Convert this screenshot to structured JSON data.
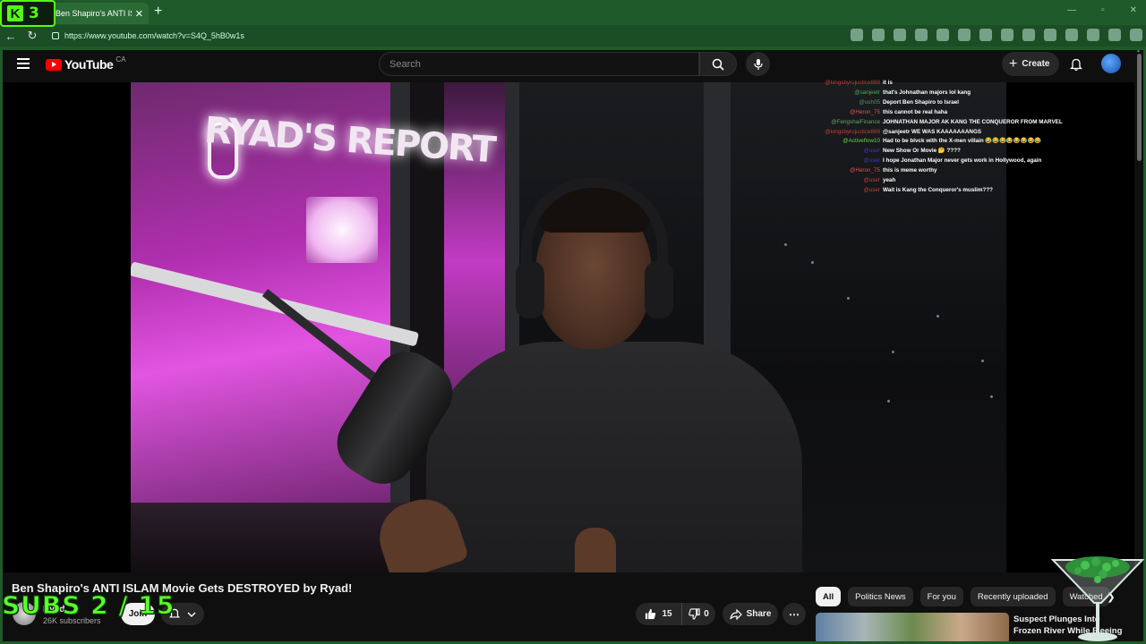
{
  "browser": {
    "kick_count": "3",
    "tab_title": "Ben Shapiro's ANTI ISLAM Movie",
    "url": "https://www.youtube.com/watch?v=S4Q_5hB0w1s"
  },
  "header": {
    "logo_text": "YouTube",
    "country": "CA",
    "search_placeholder": "Search",
    "create_label": "Create"
  },
  "video": {
    "neon_text": "RYAD'S REPORT",
    "title": "Ben Shapiro's ANTI ISLAM Movie Gets DESTROYED by Ryad!"
  },
  "chat": [
    {
      "user": "@kingsbyrujustice888",
      "msg": "it is",
      "color": "#c83d3d"
    },
    {
      "user": "@sanjeetr",
      "msg": "that's Johnathan majors lol kang",
      "color": "#4caf50"
    },
    {
      "user": "@soh05",
      "msg": "Deport Ben Shapiro to Israel",
      "color": "#5a8f6a"
    },
    {
      "user": "@Heron_75",
      "msg": "this cannot be real haha",
      "color": "#e05252"
    },
    {
      "user": "@FengshaiFinance",
      "msg": "JOHNATHAN MAJOR AK KANG THE CONQUEROR FROM MARVEL",
      "color": "#5fa85f"
    },
    {
      "user": "@kingsbyrujustice888",
      "msg": "@sanjeetr WE WAS KAAAAAAANGS",
      "color": "#c83d3d"
    },
    {
      "user": "@Activeflow10",
      "msg": "Had to be blvck with the X-men villain 😂😂😂😂😂😂😂😂",
      "color": "#6fcf4f"
    },
    {
      "user": "@user",
      "msg": "New Show Or Movie 🤔 ????",
      "color": "#3a3ac8"
    },
    {
      "user": "@user",
      "msg": "I hope Jonathan Major never gets work in Hollywood, again",
      "color": "#3a3ac8"
    },
    {
      "user": "@Heron_75",
      "msg": "this is meme worthy",
      "color": "#e05252"
    },
    {
      "user": "@user",
      "msg": "yeah",
      "color": "#c83d3d"
    },
    {
      "user": "@user",
      "msg": "Wait is Kang the Conqueror's muslim???",
      "color": "#c83d3d"
    }
  ],
  "channel": {
    "name": "Ryad",
    "subscribers": "26K subscribers",
    "join_label": "Join"
  },
  "overlay": {
    "subs_goal": "SUBS 2 / 15"
  },
  "actions": {
    "like_count": "15",
    "dislike_count": "0",
    "share_label": "Share"
  },
  "chips": [
    "All",
    "Politics News",
    "For you",
    "Recently uploaded",
    "Watched"
  ],
  "recommendation": {
    "title": "Suspect Plunges Into Frozen River While Fleeing"
  }
}
